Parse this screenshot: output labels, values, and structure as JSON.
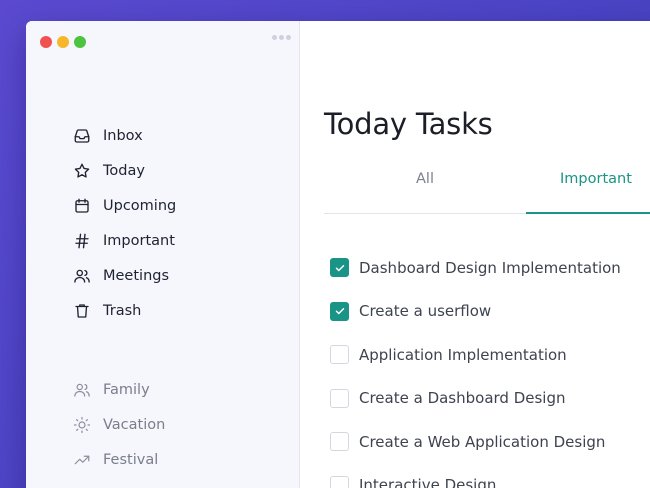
{
  "sidebar": {
    "nav": [
      {
        "label": "Inbox",
        "icon": "inbox-icon"
      },
      {
        "label": "Today",
        "icon": "star-icon"
      },
      {
        "label": "Upcoming",
        "icon": "calendar-icon"
      },
      {
        "label": "Important",
        "icon": "hash-icon"
      },
      {
        "label": "Meetings",
        "icon": "users-icon"
      },
      {
        "label": "Trash",
        "icon": "trash-icon"
      }
    ],
    "tags": [
      {
        "label": "Family",
        "icon": "users-icon"
      },
      {
        "label": "Vacation",
        "icon": "sun-icon"
      },
      {
        "label": "Festival",
        "icon": "trending-up-icon"
      }
    ]
  },
  "main": {
    "title": "Today Tasks",
    "tabs": [
      {
        "label": "All",
        "active": false
      },
      {
        "label": "Important",
        "active": true
      }
    ],
    "tasks": [
      {
        "text": "Dashboard Design Implementation",
        "checked": true
      },
      {
        "text": "Create a userflow",
        "checked": true
      },
      {
        "text": "Application Implementation",
        "checked": false
      },
      {
        "text": "Create a Dashboard Design",
        "checked": false
      },
      {
        "text": "Create a Web Application Design",
        "checked": false
      },
      {
        "text": "Interactive Design",
        "checked": false
      }
    ]
  },
  "colors": {
    "accent": "#1a9486",
    "background": "#4a44c4",
    "sidebar": "#f5f7fd"
  }
}
